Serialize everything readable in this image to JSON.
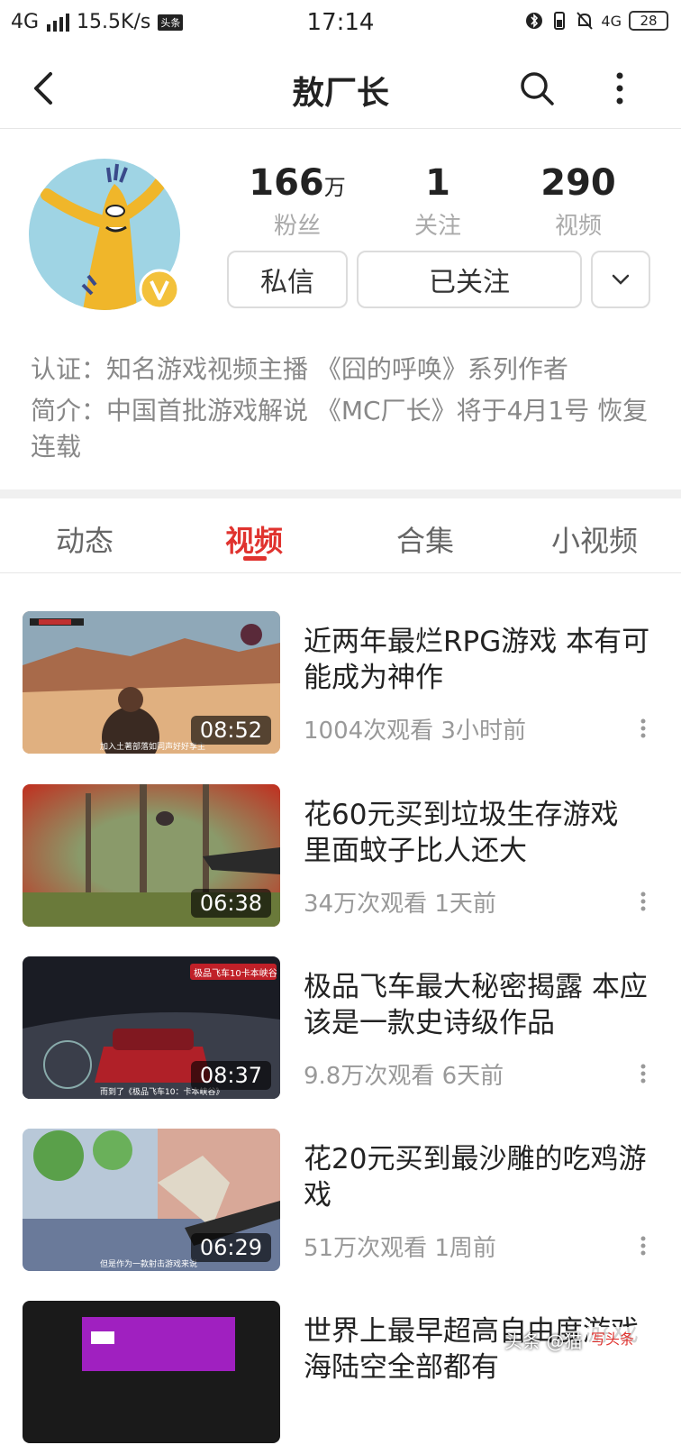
{
  "status_bar": {
    "network": "4G",
    "speed": "15.5K/s",
    "app_badge": "头条",
    "time": "17:14",
    "network_right": "4G",
    "battery": "28"
  },
  "nav": {
    "title": "敖厂长",
    "icons": [
      "back-icon",
      "search-icon",
      "more-vertical-icon"
    ]
  },
  "profile": {
    "stats": [
      {
        "num": "166",
        "unit": "万",
        "label": "粉丝"
      },
      {
        "num": "1",
        "unit": "",
        "label": "关注"
      },
      {
        "num": "290",
        "unit": "",
        "label": "视频"
      }
    ],
    "message_button": "私信",
    "follow_button": "已关注",
    "cert": "认证：知名游戏视频主播 《囧的呼唤》系列作者",
    "intro": "简介：中国首批游戏解说 《MC厂长》将于4月1号 恢复连载"
  },
  "tabs": [
    "动态",
    "视频",
    "合集",
    "小视频"
  ],
  "active_tab": "视频",
  "accent_color": "#e0332f",
  "videos": [
    {
      "title": "近两年最烂RPG游戏 本有可能成为神作",
      "duration": "08:52",
      "meta": "1004次观看  3小时前",
      "thumb_caption": "加入土著部落如同声好好享主"
    },
    {
      "title": "花60元买到垃圾生存游戏 里面蚊子比人还大",
      "duration": "06:38",
      "meta": "34万次观看  1天前",
      "thumb_caption": ""
    },
    {
      "title": "极品飞车最大秘密揭露 本应该是一款史诗级作品",
      "duration": "08:37",
      "meta": "9.8万次观看  6天前",
      "thumb_caption": "而到了《极品飞车10：卡本峡谷》",
      "thumb_banner": "极品飞车10卡本峡谷"
    },
    {
      "title": "花20元买到最沙雕的吃鸡游戏",
      "duration": "06:29",
      "meta": "51万次观看  1周前",
      "thumb_caption": "但是作为一款射击游戏来说"
    },
    {
      "title": "世界上最早超高自由度游戏 海陆空全部都有",
      "duration": "",
      "meta": "",
      "thumb_caption": ""
    }
  ],
  "watermark": {
    "text": "头条 @猫",
    "site": "写头条"
  }
}
